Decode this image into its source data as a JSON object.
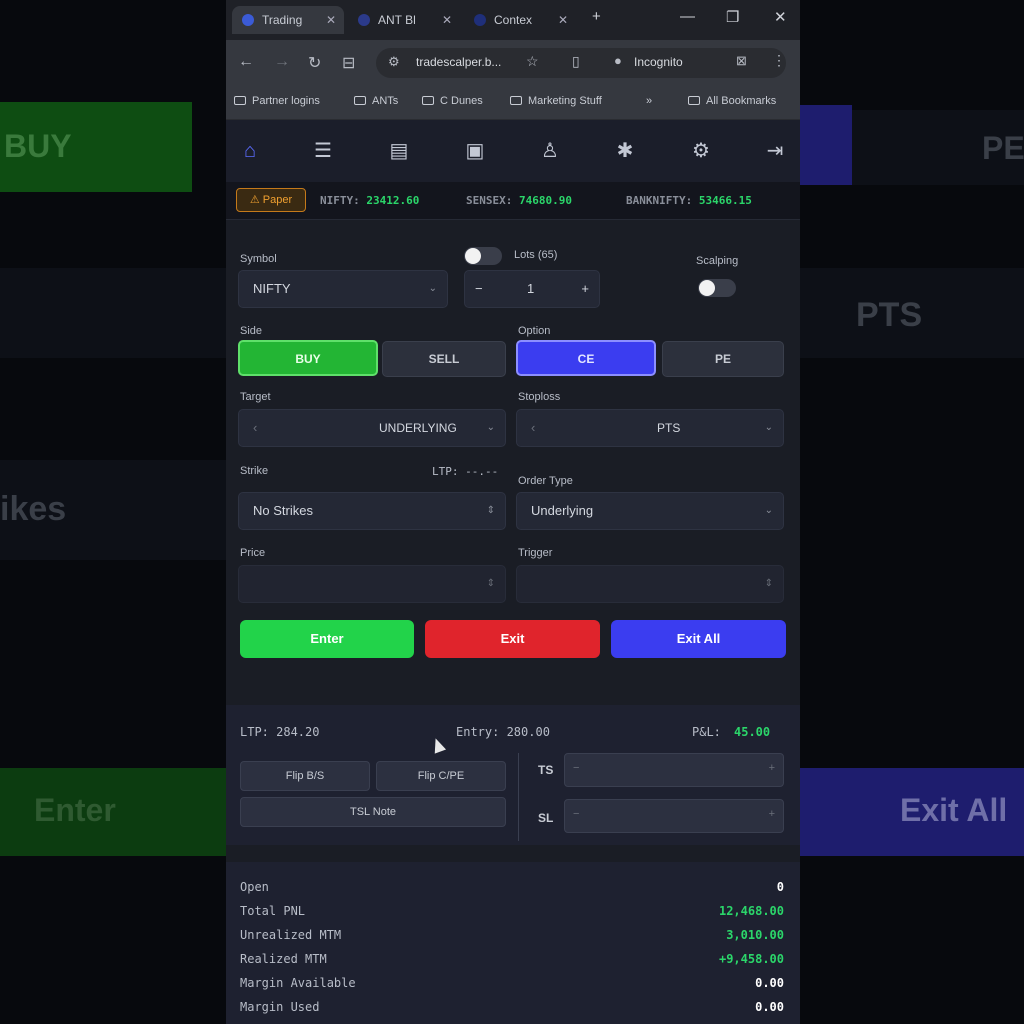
{
  "background": {
    "buy": "BUY",
    "pe": "PE",
    "pts": "PTS",
    "ikes": "ikes",
    "enter": "Enter",
    "exit_all": "Exit All"
  },
  "browser": {
    "tabs": [
      {
        "label": "Trading"
      },
      {
        "label": "ANT Bl"
      },
      {
        "label": "Contex"
      }
    ],
    "url": "tradescalper.b...",
    "incognito": "Incognito",
    "bookmarks": [
      "Partner logins",
      "ANTs",
      "C Dunes",
      "Marketing Stuff",
      "All Bookmarks"
    ]
  },
  "ticker": {
    "badge": "⚠ Paper",
    "items": [
      {
        "name": "NIFTY:",
        "value": "23412.60"
      },
      {
        "name": "SENSEX:",
        "value": "74680.90"
      },
      {
        "name": "BANKNIFTY:",
        "value": "53466.15"
      }
    ]
  },
  "form": {
    "symbol_label": "Symbol",
    "symbol_value": "NIFTY",
    "lots_label": "Lots (65)",
    "lots_value": "1",
    "lots_minus": "−",
    "lots_plus": "+",
    "scalping_label": "Scalping",
    "side_label": "Side",
    "buy": "BUY",
    "sell": "SELL",
    "option_label": "Option",
    "ce": "CE",
    "pe": "PE",
    "target_label": "Target",
    "target_mode": "UNDERLYING",
    "stoploss_label": "Stoploss",
    "stoploss_mode": "PTS",
    "strike_label": "Strike",
    "ltp_label": "LTP: --.--",
    "strike_value": "No Strikes",
    "order_type_label": "Order Type",
    "order_type_value": "Underlying",
    "price_label": "Price",
    "trigger_label": "Trigger"
  },
  "actions": {
    "enter": "Enter",
    "exit": "Exit",
    "exit_all": "Exit All"
  },
  "position": {
    "ltp": "LTP: 284.20",
    "entry": "Entry: 280.00",
    "pnl_label": "P&L:",
    "pnl_value": "45.00",
    "flip_bs": "Flip B/S",
    "flip_cpe": "Flip C/PE",
    "tsl_note": "TSL Note",
    "ts_label": "TS",
    "sl_label": "SL"
  },
  "summary": [
    {
      "label": "Open",
      "value": "0",
      "color": "#ffffff"
    },
    {
      "label": "Total PNL",
      "value": "12,468.00",
      "color": "#2bd66a"
    },
    {
      "label": "Unrealized MTM",
      "value": "3,010.00",
      "color": "#2bd66a"
    },
    {
      "label": "Realized MTM",
      "value": "+9,458.00",
      "color": "#2bd66a"
    },
    {
      "label": "Margin Available",
      "value": "0.00",
      "color": "#ffffff"
    },
    {
      "label": "Margin Used",
      "value": "0.00",
      "color": "#ffffff"
    }
  ],
  "colors": {
    "accent": "#5b6cff",
    "buy": "#23b534",
    "exit": "#e0242c",
    "exit_all": "#3b3df0",
    "profit": "#2bd66a"
  }
}
